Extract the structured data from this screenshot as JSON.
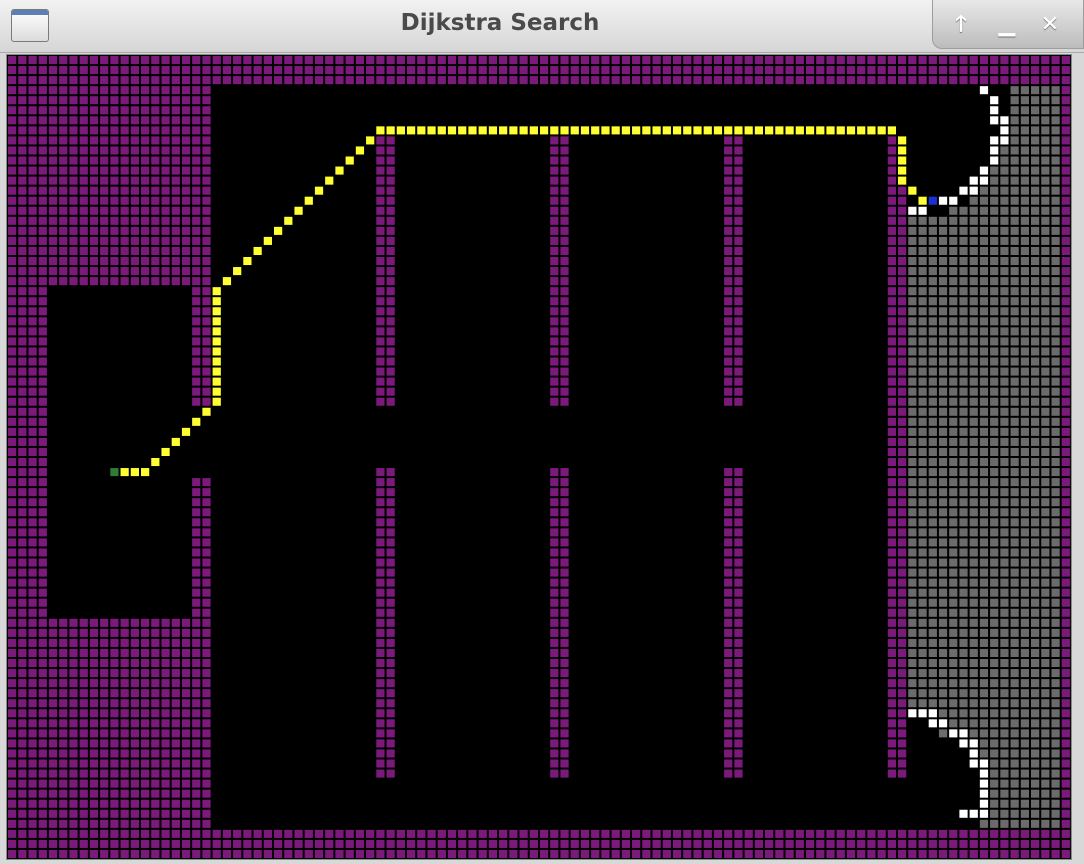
{
  "window": {
    "title": "Dijkstra Search",
    "buttons": {
      "maximize": "🡑",
      "minimize": "▁",
      "close": "✕"
    }
  },
  "grid": {
    "cols": 104,
    "rows": 80,
    "colors": {
      "wall": "#7c1a7c",
      "open": "#000000",
      "frontier": "#6b6b6b",
      "gridline": "#3a3a3a",
      "path": "#ffff33",
      "visited_edge": "#ffffff",
      "start": "#2e7d32",
      "goal": "#1a2fd6"
    },
    "open_regions": [
      {
        "c0": 20,
        "c1": 87,
        "r0": 3,
        "r1": 76
      },
      {
        "c0": 4,
        "c1": 17,
        "r0": 23,
        "r1": 55
      },
      {
        "c0": 18,
        "c1": 19,
        "r0": 35,
        "r1": 41
      }
    ],
    "frontier_region": {
      "c0": 88,
      "c1": 102,
      "r0": 3,
      "r1": 76
    },
    "walls": [
      {
        "c0": 36,
        "c1": 37,
        "r0": 8,
        "r1": 34
      },
      {
        "c0": 36,
        "c1": 37,
        "r0": 41,
        "r1": 71
      },
      {
        "c0": 53,
        "c1": 54,
        "r0": 8,
        "r1": 34
      },
      {
        "c0": 53,
        "c1": 54,
        "r0": 41,
        "r1": 71
      },
      {
        "c0": 70,
        "c1": 71,
        "r0": 8,
        "r1": 34
      },
      {
        "c0": 70,
        "c1": 71,
        "r0": 41,
        "r1": 71
      },
      {
        "c0": 86,
        "c1": 87,
        "r0": 8,
        "r1": 71
      }
    ],
    "black_pockets": [
      {
        "c": 88,
        "r0": 3,
        "r1": 15
      },
      {
        "c": 89,
        "r0": 3,
        "r1": 15
      },
      {
        "c": 90,
        "r0": 3,
        "r1": 15
      },
      {
        "c": 91,
        "r0": 3,
        "r1": 15
      },
      {
        "c": 92,
        "r0": 3,
        "r1": 14
      },
      {
        "c": 93,
        "r0": 3,
        "r1": 14
      },
      {
        "c": 94,
        "r0": 3,
        "r1": 13
      },
      {
        "c": 95,
        "r0": 3,
        "r1": 12
      },
      {
        "c": 96,
        "r0": 3,
        "r1": 10
      },
      {
        "c": 97,
        "r0": 3,
        "r1": 8
      },
      {
        "c": 88,
        "r0": 66,
        "r1": 76
      },
      {
        "c": 89,
        "r0": 66,
        "r1": 76
      },
      {
        "c": 90,
        "r0": 67,
        "r1": 76
      },
      {
        "c": 91,
        "r0": 68,
        "r1": 76
      },
      {
        "c": 92,
        "r0": 68,
        "r1": 76
      },
      {
        "c": 93,
        "r0": 69,
        "r1": 76
      },
      {
        "c": 94,
        "r0": 70,
        "r1": 76
      }
    ],
    "visited_edge": [
      [
        95,
        3
      ],
      [
        96,
        4
      ],
      [
        96,
        5
      ],
      [
        96,
        6
      ],
      [
        97,
        6
      ],
      [
        97,
        7
      ],
      [
        97,
        8
      ],
      [
        96,
        8
      ],
      [
        96,
        9
      ],
      [
        96,
        10
      ],
      [
        95,
        11
      ],
      [
        95,
        12
      ],
      [
        94,
        12
      ],
      [
        94,
        13
      ],
      [
        93,
        13
      ],
      [
        92,
        14
      ],
      [
        91,
        14
      ],
      [
        90,
        14
      ],
      [
        89,
        15
      ],
      [
        88,
        15
      ],
      [
        89,
        14
      ],
      [
        88,
        65
      ],
      [
        89,
        65
      ],
      [
        90,
        65
      ],
      [
        90,
        66
      ],
      [
        91,
        66
      ],
      [
        92,
        67
      ],
      [
        93,
        67
      ],
      [
        93,
        68
      ],
      [
        94,
        68
      ],
      [
        94,
        69
      ],
      [
        94,
        70
      ],
      [
        95,
        70
      ],
      [
        95,
        71
      ],
      [
        95,
        72
      ],
      [
        95,
        73
      ],
      [
        95,
        74
      ],
      [
        95,
        75
      ],
      [
        94,
        75
      ],
      [
        93,
        75
      ]
    ],
    "path": [
      [
        11,
        41
      ],
      [
        12,
        41
      ],
      [
        13,
        41
      ],
      [
        14,
        40
      ],
      [
        15,
        39
      ],
      [
        16,
        38
      ],
      [
        17,
        37
      ],
      [
        18,
        36
      ],
      [
        19,
        35
      ],
      [
        20,
        34
      ],
      [
        20,
        33
      ],
      [
        20,
        32
      ],
      [
        20,
        31
      ],
      [
        20,
        30
      ],
      [
        20,
        29
      ],
      [
        20,
        28
      ],
      [
        20,
        27
      ],
      [
        20,
        26
      ],
      [
        20,
        25
      ],
      [
        20,
        24
      ],
      [
        20,
        23
      ],
      [
        21,
        22
      ],
      [
        22,
        21
      ],
      [
        23,
        20
      ],
      [
        24,
        19
      ],
      [
        25,
        18
      ],
      [
        26,
        17
      ],
      [
        27,
        16
      ],
      [
        28,
        15
      ],
      [
        29,
        14
      ],
      [
        30,
        13
      ],
      [
        31,
        12
      ],
      [
        32,
        11
      ],
      [
        33,
        10
      ],
      [
        34,
        9
      ],
      [
        35,
        8
      ],
      [
        36,
        7
      ],
      [
        37,
        7
      ],
      [
        38,
        7
      ],
      [
        39,
        7
      ],
      [
        40,
        7
      ],
      [
        41,
        7
      ],
      [
        42,
        7
      ],
      [
        43,
        7
      ],
      [
        44,
        7
      ],
      [
        45,
        7
      ],
      [
        46,
        7
      ],
      [
        47,
        7
      ],
      [
        48,
        7
      ],
      [
        49,
        7
      ],
      [
        50,
        7
      ],
      [
        51,
        7
      ],
      [
        52,
        7
      ],
      [
        53,
        7
      ],
      [
        54,
        7
      ],
      [
        55,
        7
      ],
      [
        56,
        7
      ],
      [
        57,
        7
      ],
      [
        58,
        7
      ],
      [
        59,
        7
      ],
      [
        60,
        7
      ],
      [
        61,
        7
      ],
      [
        62,
        7
      ],
      [
        63,
        7
      ],
      [
        64,
        7
      ],
      [
        65,
        7
      ],
      [
        66,
        7
      ],
      [
        67,
        7
      ],
      [
        68,
        7
      ],
      [
        69,
        7
      ],
      [
        70,
        7
      ],
      [
        71,
        7
      ],
      [
        72,
        7
      ],
      [
        73,
        7
      ],
      [
        74,
        7
      ],
      [
        75,
        7
      ],
      [
        76,
        7
      ],
      [
        77,
        7
      ],
      [
        78,
        7
      ],
      [
        79,
        7
      ],
      [
        80,
        7
      ],
      [
        81,
        7
      ],
      [
        82,
        7
      ],
      [
        83,
        7
      ],
      [
        84,
        7
      ],
      [
        85,
        7
      ],
      [
        86,
        7
      ],
      [
        87,
        8
      ],
      [
        87,
        9
      ],
      [
        87,
        10
      ],
      [
        87,
        11
      ],
      [
        87,
        12
      ],
      [
        88,
        13
      ],
      [
        89,
        14
      ]
    ],
    "start": [
      10,
      41
    ],
    "goal": [
      90,
      14
    ]
  }
}
